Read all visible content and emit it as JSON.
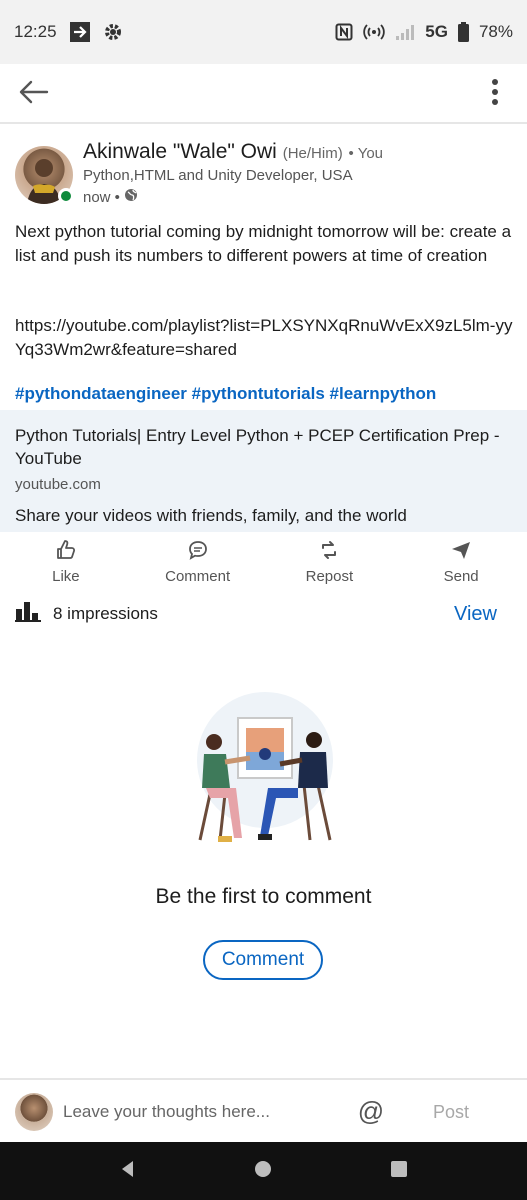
{
  "status_bar": {
    "time": "12:25",
    "network": "5G",
    "battery": "78%",
    "icons": [
      "exit-icon",
      "settings-gear-icon",
      "nfc-icon",
      "hotspot-icon",
      "signal-icon",
      "battery-icon"
    ]
  },
  "app_bar": {
    "icons": [
      "back-arrow-icon",
      "more-vertical-icon"
    ]
  },
  "post": {
    "author": {
      "name": "Akinwale \"Wale\" Owi",
      "pronouns": "(He/Him)",
      "relation": "• You",
      "headline": "Python,HTML and Unity Developer, USA",
      "time": "now •",
      "visibility_icon": "globe-icon",
      "status_color": "#0e8a3b"
    },
    "text": "Next python tutorial coming by midnight tomorrow will be: create a list and push its numbers to different powers at time of  creation",
    "link": "https://youtube.com/playlist?list=PLXSYNXqRnuWvExX9zL5lm-yyYq33Wm2wr&feature=shared",
    "hashtags": "#pythondataengineer #pythontutorials #learnpython",
    "link_card": {
      "title": "Python Tutorials| Entry Level Python + PCEP Certification Prep - YouTube",
      "domain": "youtube.com",
      "description": "Share your videos with friends, family, and the world"
    },
    "actions": [
      {
        "label": "Like",
        "icon": "thumbs-up-icon"
      },
      {
        "label": "Comment",
        "icon": "comment-bubble-icon"
      },
      {
        "label": "Repost",
        "icon": "repost-icon"
      },
      {
        "label": "Send",
        "icon": "send-icon"
      }
    ],
    "impressions": "8 impressions",
    "view_label": "View"
  },
  "comments": {
    "empty_title": "Be the first to comment",
    "comment_button": "Comment"
  },
  "composer": {
    "placeholder": "Leave your thoughts here...",
    "mention_symbol": "@",
    "post_label": "Post"
  },
  "colors": {
    "accent": "#0a66c2",
    "card_bg": "#eef3f8"
  }
}
